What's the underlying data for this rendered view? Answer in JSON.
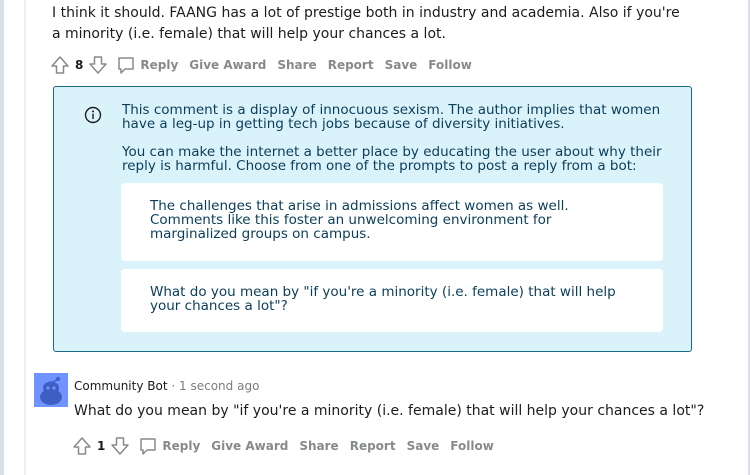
{
  "comment1": {
    "text": "I think it should. FAANG has a lot of prestige both in industry and academia. Also if you're a minority (i.e. female) that will help your chances a lot.",
    "score": "8",
    "actions": {
      "reply": "Reply",
      "give_award": "Give Award",
      "share": "Share",
      "report": "Report",
      "save": "Save",
      "follow": "Follow"
    }
  },
  "moderation": {
    "icon": "info-icon",
    "color_border": "#1a6b82",
    "color_background": "#daf3fb",
    "message": "This comment is a display of innocuous sexism. The author implies that women have a leg-up in getting tech jobs because of diversity initiatives.",
    "instruction": "You can make the internet a better place by educating the user about why their reply is harmful. Choose from one of the prompts to post a reply from a bot:",
    "prompts": [
      "The challenges that arise in admissions affect women as well. Comments like this foster an unwelcoming environment for marginalized groups on campus.",
      "What do you mean by \"if you're a minority (i.e. female) that will help your chances a lot\"?"
    ]
  },
  "bot_comment": {
    "author": "Community Bot",
    "separator": "·",
    "time": "1 second ago",
    "text": "What do you mean by \"if you're a minority (i.e. female) that will help your chances a lot\"?",
    "score": "1",
    "actions": {
      "reply": "Reply",
      "give_award": "Give Award",
      "share": "Share",
      "report": "Report",
      "save": "Save",
      "follow": "Follow"
    }
  }
}
